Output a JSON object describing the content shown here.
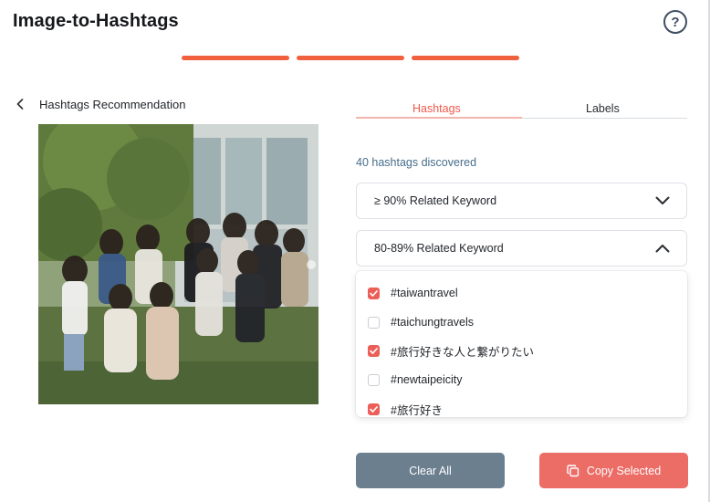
{
  "app": {
    "title": "Image-to-Hashtags"
  },
  "header": {
    "help_glyph": "?"
  },
  "progress": {
    "steps": 3,
    "completed": 3,
    "color": "#f0603e"
  },
  "section": {
    "back_label": "Hashtags Recommendation"
  },
  "tabs": [
    {
      "label": "Hashtags",
      "active": true
    },
    {
      "label": "Labels",
      "active": false
    }
  ],
  "results": {
    "count_text": "40 hashtags discovered"
  },
  "accordions": [
    {
      "label": "≥ 90% Related Keyword",
      "expanded": false
    },
    {
      "label": "80-89% Related Keyword",
      "expanded": true
    }
  ],
  "hashtags": [
    {
      "label": "#taiwantravel",
      "checked": true
    },
    {
      "label": "#taichungtravels",
      "checked": false
    },
    {
      "label": "#旅行好きな人と繋がりたい",
      "checked": true
    },
    {
      "label": "#newtaipeicity",
      "checked": false
    },
    {
      "label": "#旅行好き",
      "checked": true
    }
  ],
  "buttons": {
    "clear": "Clear All",
    "copy": "Copy Selected"
  },
  "colors": {
    "accent": "#ec5f58",
    "clear_button": "#6c7f8f",
    "copy_button": "#ec6c66",
    "link_blue": "#466e8c"
  }
}
